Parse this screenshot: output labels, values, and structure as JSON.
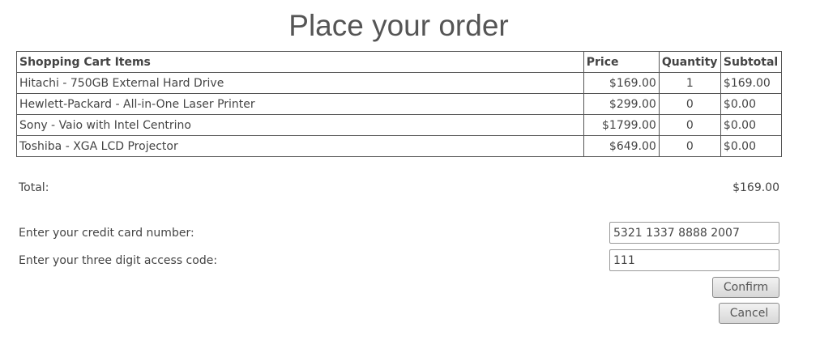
{
  "page": {
    "title": "Place your order"
  },
  "cart": {
    "headers": {
      "item": "Shopping Cart Items",
      "price": "Price",
      "quantity": "Quantity",
      "subtotal": "Subtotal"
    },
    "rows": [
      {
        "item": "Hitachi - 750GB External Hard Drive",
        "price": "$169.00",
        "quantity": "1",
        "subtotal": "$169.00"
      },
      {
        "item": "Hewlett-Packard - All-in-One Laser Printer",
        "price": "$299.00",
        "quantity": "0",
        "subtotal": "$0.00"
      },
      {
        "item": "Sony - Vaio with Intel Centrino",
        "price": "$1799.00",
        "quantity": "0",
        "subtotal": "$0.00"
      },
      {
        "item": "Toshiba - XGA LCD Projector",
        "price": "$649.00",
        "quantity": "0",
        "subtotal": "$0.00"
      }
    ],
    "total_label": "Total:",
    "total_value": "$169.00"
  },
  "form": {
    "card_label": "Enter your credit card number:",
    "card_value": "5321 1337 8888 2007",
    "code_label": "Enter your three digit access code:",
    "code_value": "111",
    "confirm_label": "Confirm",
    "cancel_label": "Cancel"
  }
}
